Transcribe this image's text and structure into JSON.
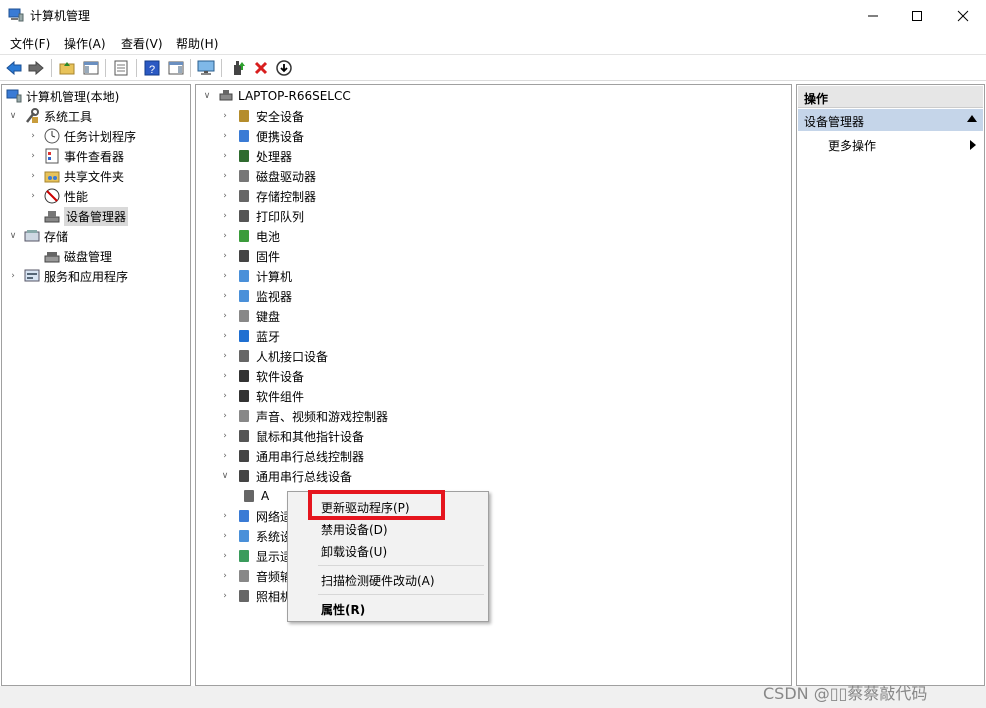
{
  "window": {
    "title": "计算机管理"
  },
  "menu": [
    "文件(F)",
    "操作(A)",
    "查看(V)",
    "帮助(H)"
  ],
  "left_tree": [
    {
      "label": "计算机管理(本地)",
      "chev": "",
      "icon": "computer-management-icon"
    },
    {
      "label": "系统工具",
      "chev": "expanded",
      "icon": "system-tools-icon"
    },
    {
      "label": "任务计划程序",
      "chev": "collapsed",
      "icon": "task-scheduler-icon"
    },
    {
      "label": "事件查看器",
      "chev": "collapsed",
      "icon": "event-viewer-icon"
    },
    {
      "label": "共享文件夹",
      "chev": "collapsed",
      "icon": "shared-folders-icon"
    },
    {
      "label": "性能",
      "chev": "collapsed",
      "icon": "performance-icon"
    },
    {
      "label": "设备管理器",
      "chev": "",
      "icon": "device-manager-icon",
      "selected": true
    },
    {
      "label": "存储",
      "chev": "expanded",
      "icon": "storage-icon"
    },
    {
      "label": "磁盘管理",
      "chev": "",
      "icon": "disk-management-icon"
    },
    {
      "label": "服务和应用程序",
      "chev": "collapsed",
      "icon": "services-apps-icon"
    }
  ],
  "device_tree": {
    "root": "LAPTOP-R66SELCC",
    "items": [
      {
        "label": "安全设备",
        "icon": "security-device-icon"
      },
      {
        "label": "便携设备",
        "icon": "portable-device-icon"
      },
      {
        "label": "处理器",
        "icon": "processor-icon"
      },
      {
        "label": "磁盘驱动器",
        "icon": "disk-drive-icon"
      },
      {
        "label": "存储控制器",
        "icon": "storage-controller-icon"
      },
      {
        "label": "打印队列",
        "icon": "print-queue-icon"
      },
      {
        "label": "电池",
        "icon": "battery-icon"
      },
      {
        "label": "固件",
        "icon": "firmware-icon"
      },
      {
        "label": "计算机",
        "icon": "computer-icon"
      },
      {
        "label": "监视器",
        "icon": "monitor-icon"
      },
      {
        "label": "键盘",
        "icon": "keyboard-icon"
      },
      {
        "label": "蓝牙",
        "icon": "bluetooth-icon"
      },
      {
        "label": "人机接口设备",
        "icon": "hid-icon"
      },
      {
        "label": "软件设备",
        "icon": "software-device-icon"
      },
      {
        "label": "软件组件",
        "icon": "software-component-icon"
      },
      {
        "label": "声音、视频和游戏控制器",
        "icon": "sound-icon"
      },
      {
        "label": "鼠标和其他指针设备",
        "icon": "mouse-icon"
      },
      {
        "label": "通用串行总线控制器",
        "icon": "usb-controller-icon"
      },
      {
        "label": "通用串行总线设备",
        "icon": "usb-device-icon",
        "expanded": true
      },
      {
        "label": "A",
        "icon": "usb-child-icon",
        "child": true
      },
      {
        "label": "网络适",
        "icon": "network-adapter-icon"
      },
      {
        "label": "系统设",
        "icon": "system-device-icon"
      },
      {
        "label": "显示适",
        "icon": "display-adapter-icon"
      },
      {
        "label": "音频输",
        "icon": "audio-io-icon"
      },
      {
        "label": "照相机",
        "icon": "camera-icon"
      }
    ]
  },
  "actions_pane": {
    "header": "操作",
    "section": "设备管理器",
    "more": "更多操作"
  },
  "context_menu": {
    "update_driver": "更新驱动程序(P)",
    "disable": "禁用设备(D)",
    "uninstall": "卸载设备(U)",
    "scan": "扫描检测硬件改动(A)",
    "properties": "属性(R)"
  },
  "watermark": "CSDN @▯▯蔡蔡敲代码",
  "colors": {
    "highlight_box": "#e5151e",
    "section_bg": "#c5d5e9"
  }
}
